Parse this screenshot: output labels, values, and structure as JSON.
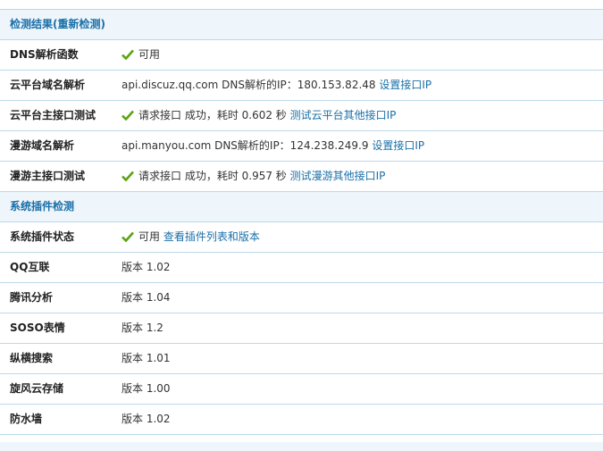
{
  "sections": {
    "detect_title": "检测结果(重新检测)",
    "plugin_title": "系统插件检测"
  },
  "rows": {
    "dns": {
      "label": "DNS解析函数",
      "status": "可用"
    },
    "cloud_domain": {
      "label": "云平台域名解析",
      "text": "api.discuz.qq.com DNS解析的IP：180.153.82.48",
      "link": "设置接口IP"
    },
    "cloud_main": {
      "label": "云平台主接口测试",
      "text": "请求接口 成功，耗时 0.602 秒",
      "link": "测试云平台其他接口IP"
    },
    "manyou_domain": {
      "label": "漫游域名解析",
      "text": "api.manyou.com DNS解析的IP：124.238.249.9",
      "link": "设置接口IP"
    },
    "manyou_main": {
      "label": "漫游主接口测试",
      "text": "请求接口 成功，耗时 0.957 秒",
      "link": "测试漫游其他接口IP"
    },
    "plugin_status": {
      "label": "系统插件状态",
      "status": "可用",
      "link": "查看插件列表和版本"
    }
  },
  "plugins": [
    {
      "label": "QQ互联",
      "version": "版本 1.02"
    },
    {
      "label": "腾讯分析",
      "version": "版本 1.04"
    },
    {
      "label": "SOSO表情",
      "version": "版本 1.2"
    },
    {
      "label": "纵横搜索",
      "version": "版本 1.01"
    },
    {
      "label": "旋风云存储",
      "version": "版本 1.00"
    },
    {
      "label": "防水墙",
      "version": "版本 1.02"
    }
  ],
  "colors": {
    "link": "#1a6fa8",
    "check": "#5aa312",
    "border": "#bcd8ea",
    "section_bg": "#eef5fb"
  }
}
